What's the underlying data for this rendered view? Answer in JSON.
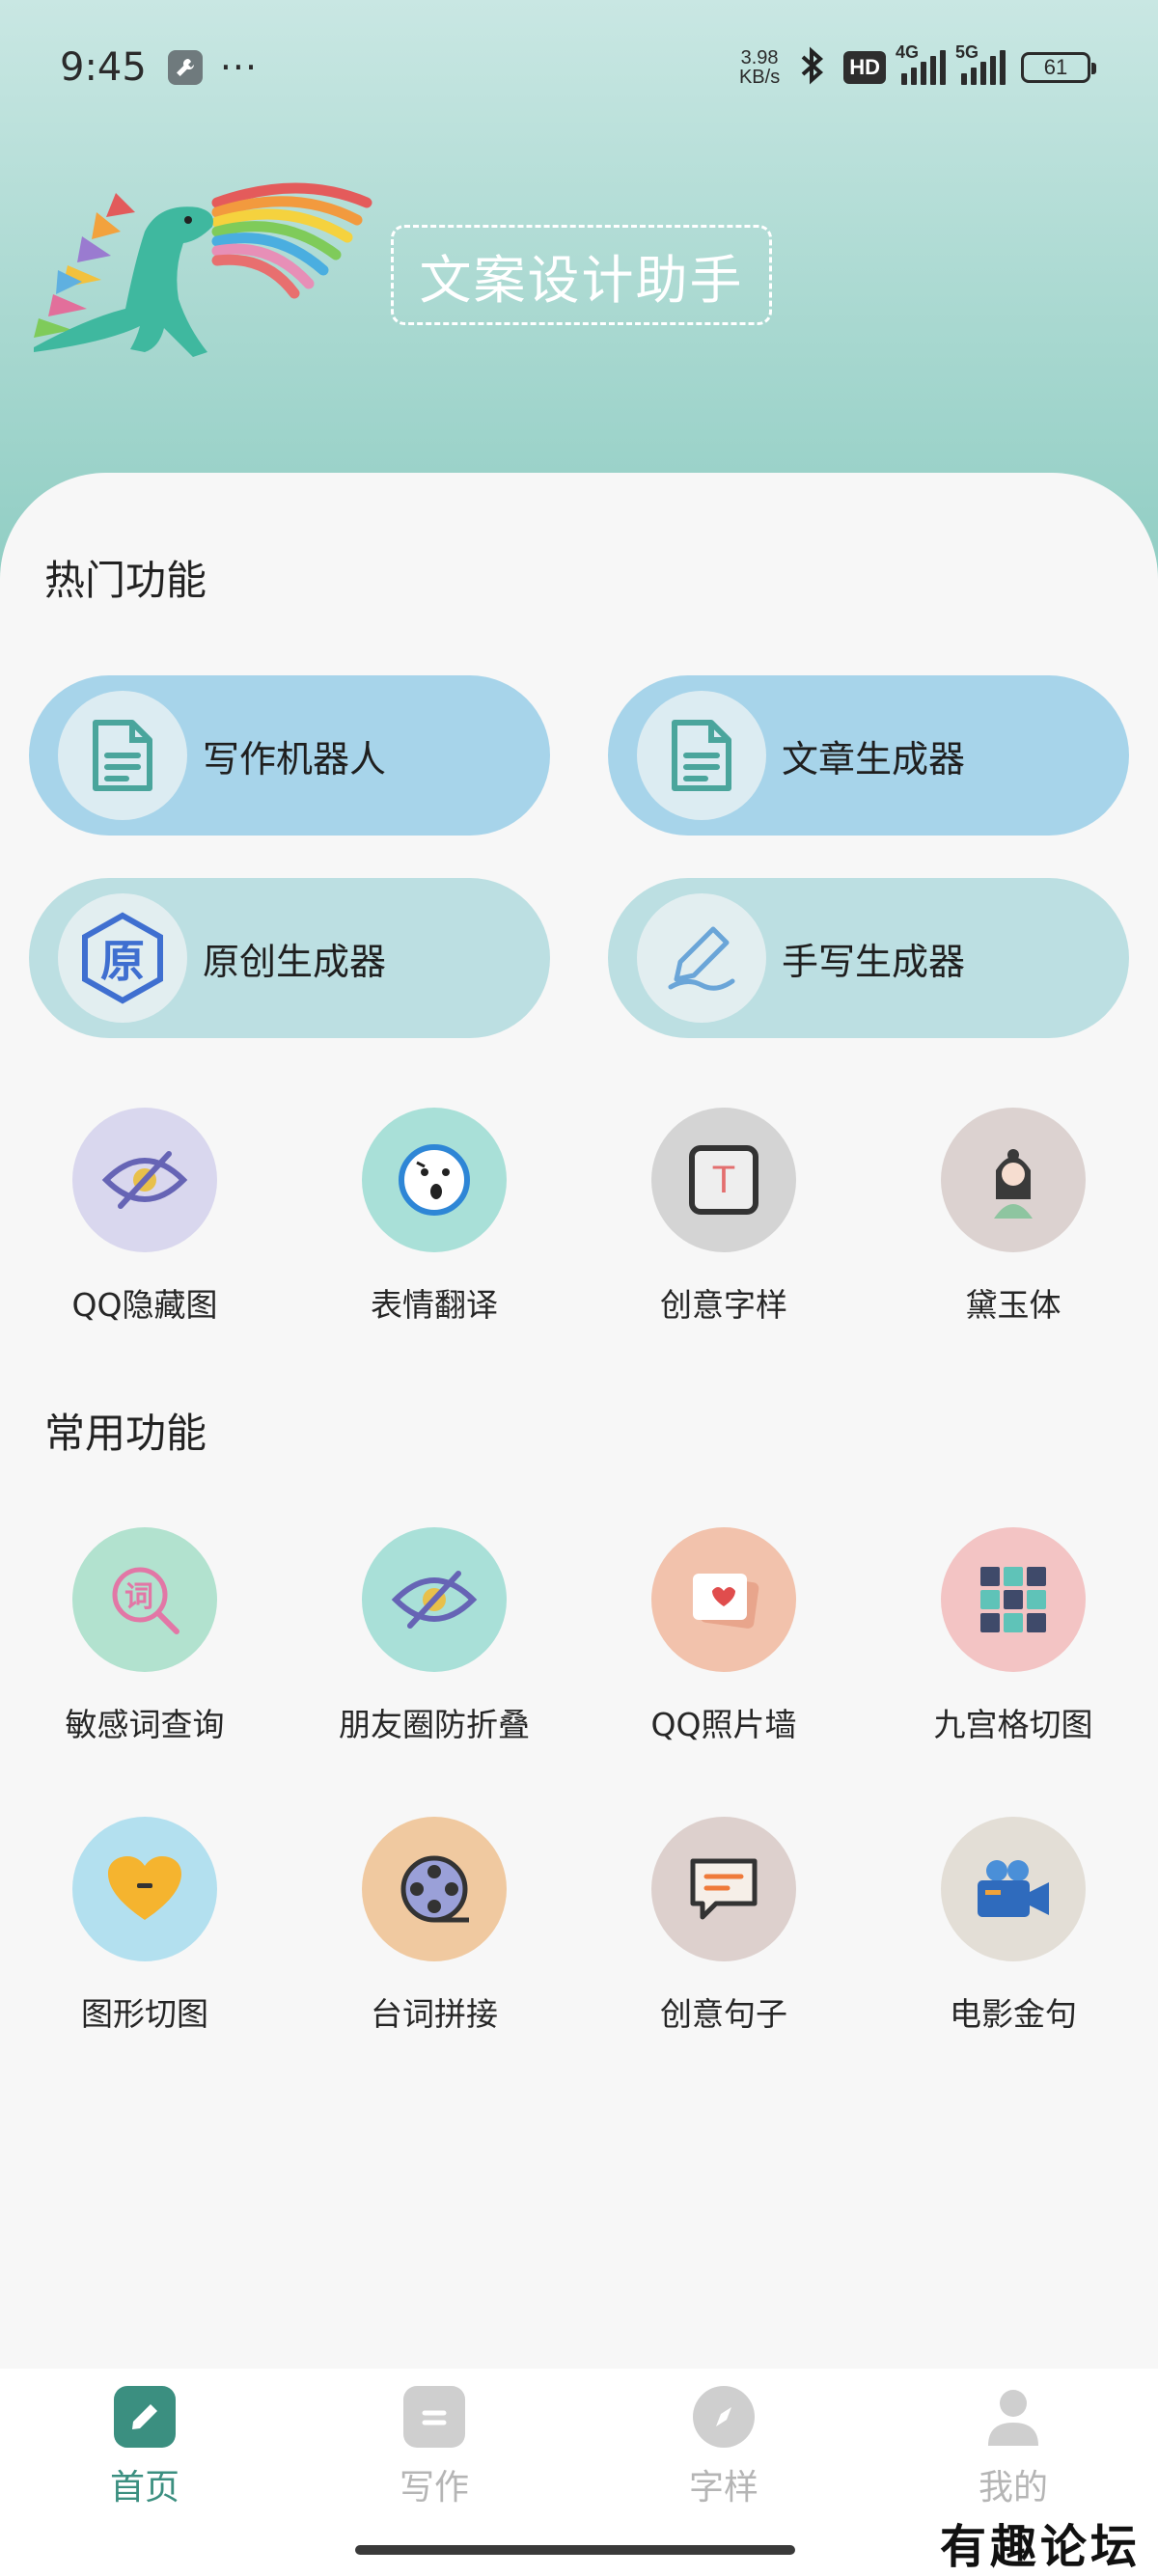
{
  "status_bar": {
    "time": "9:45",
    "more": "···",
    "net_speed_value": "3.98",
    "net_speed_unit": "KB/s",
    "hd": "HD",
    "sim1_tag": "4G",
    "sim2_tag": "5G",
    "battery": "61"
  },
  "header": {
    "title": "文案设计助手"
  },
  "hot": {
    "title": "热门功能",
    "pills": [
      {
        "label": "写作机器人"
      },
      {
        "label": "文章生成器"
      },
      {
        "label": "原创生成器",
        "icon_char": "原"
      },
      {
        "label": "手写生成器"
      }
    ],
    "grid": [
      {
        "label": "QQ隐藏图",
        "color": "#d9d7ee"
      },
      {
        "label": "表情翻译",
        "color": "#a9e0d8"
      },
      {
        "label": "创意字样",
        "color": "#d4d4d4",
        "icon_char": "T"
      },
      {
        "label": "黛玉体",
        "color": "#dcd2d0"
      }
    ]
  },
  "common": {
    "title": "常用功能",
    "grid": [
      {
        "label": "敏感词查询",
        "color": "#b2e2cf",
        "icon_char": "词"
      },
      {
        "label": "朋友圈防折叠",
        "color": "#a9e0d8"
      },
      {
        "label": "QQ照片墙",
        "color": "#f2c2ac"
      },
      {
        "label": "九宫格切图",
        "color": "#f3c4c4"
      },
      {
        "label": "图形切图",
        "color": "#b3e0ef"
      },
      {
        "label": "台词拼接",
        "color": "#f0c9a0"
      },
      {
        "label": "创意句子",
        "color": "#ddd0cd"
      },
      {
        "label": "电影金句",
        "color": "#e3ded6"
      }
    ]
  },
  "bottom_nav": [
    {
      "label": "首页",
      "active": true
    },
    {
      "label": "写作",
      "active": false
    },
    {
      "label": "字样",
      "active": false
    },
    {
      "label": "我的",
      "active": false
    }
  ],
  "watermark": "有趣论坛",
  "colors": {
    "accent": "#3b8f80",
    "pill_blue": "#a7d4ea",
    "pill_teal": "#bcdfe2"
  }
}
